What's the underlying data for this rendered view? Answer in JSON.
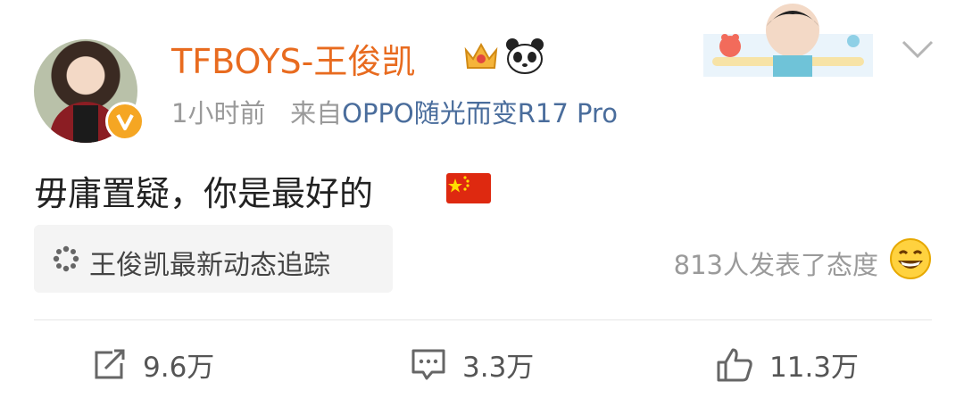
{
  "post": {
    "username": "TFBOYS-王俊凯",
    "time": "1小时前",
    "source_prefix": "来自",
    "source": "OPPO随光而变R17 Pro",
    "content": "毋庸置疑，你是最好的",
    "topic": "王俊凯最新动态追踪",
    "reactions": "813人发表了态度"
  },
  "actions": {
    "repost": "9.6万",
    "comment": "3.3万",
    "like": "11.3万"
  },
  "colors": {
    "username": "#e86b1f",
    "source": "#4a6d9c",
    "verified": "#f5a623"
  },
  "icons": [
    "verified-v-icon",
    "crown-icon",
    "panda-icon",
    "chevron-down-icon",
    "flag-china-icon",
    "topic-dots-icon",
    "grin-emoji-icon",
    "repost-icon",
    "comment-icon",
    "like-icon"
  ]
}
